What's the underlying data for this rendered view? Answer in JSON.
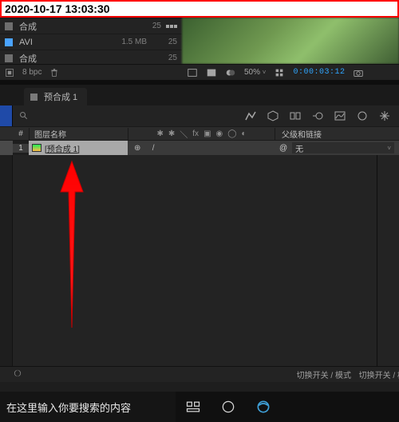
{
  "timestamp": "2020-10-17 13:03:30",
  "project": {
    "rows": [
      {
        "name": "合成",
        "meta": "",
        "rate": "25"
      },
      {
        "name": "AVI",
        "meta": "1.5 MB",
        "rate": "25"
      },
      {
        "name": "合成",
        "meta": "",
        "rate": "25"
      }
    ],
    "bpc": "8 bpc"
  },
  "viewer": {
    "zoom": "50%",
    "timecode": "0:00:03:12"
  },
  "timeline": {
    "tab": "预合成 1",
    "columns": {
      "index": "#",
      "layer_name": "图层名称",
      "parent": "父级和链接"
    },
    "layer": {
      "number": "1",
      "name": "[预合成 1]",
      "parent_value": "无"
    },
    "footer_mode": "切换开关 / 模式",
    "footer_mode_right": "切换开关 / 模"
  },
  "taskbar": {
    "search_placeholder": "在这里输入你要搜索的内容"
  }
}
